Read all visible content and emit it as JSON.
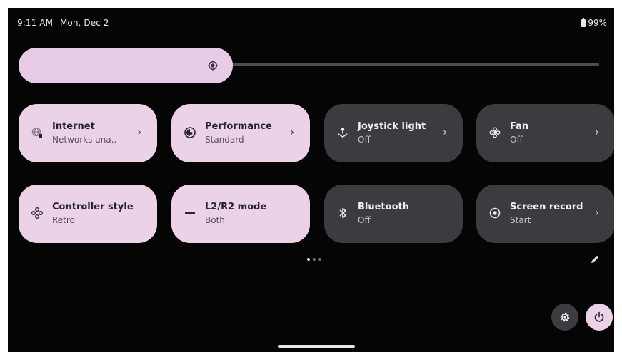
{
  "status_bar": {
    "time": "9:11 AM",
    "date": "Mon, Dec 2",
    "battery": "99%"
  },
  "brightness": {
    "level": 0.36,
    "icon": "brightness-icon"
  },
  "tiles": [
    {
      "title": "Internet",
      "subtitle": "Networks una..",
      "icon": "internet-icon",
      "state": "on",
      "has_chevron": true
    },
    {
      "title": "Performance",
      "subtitle": "Standard",
      "icon": "performance-icon",
      "state": "on",
      "has_chevron": true
    },
    {
      "title": "Joystick light",
      "subtitle": "Off",
      "icon": "joystick-icon",
      "state": "off",
      "has_chevron": true
    },
    {
      "title": "Fan",
      "subtitle": "Off",
      "icon": "fan-icon",
      "state": "off",
      "has_chevron": true
    },
    {
      "title": "Controller style",
      "subtitle": "Retro",
      "icon": "controller-icon",
      "state": "on",
      "has_chevron": false
    },
    {
      "title": "L2/R2 mode",
      "subtitle": "Both",
      "icon": "trigger-icon",
      "state": "on",
      "has_chevron": false
    },
    {
      "title": "Bluetooth",
      "subtitle": "Off",
      "icon": "bluetooth-icon",
      "state": "off",
      "has_chevron": false
    },
    {
      "title": "Screen record",
      "subtitle": "Start",
      "icon": "screen-record-icon",
      "state": "off",
      "has_chevron": true
    }
  ],
  "page_indicator": {
    "pages": 3,
    "current": 1
  },
  "colors": {
    "background": "#050505",
    "tile_on": "#ecd2e7",
    "tile_off": "#3d3b40",
    "accent": "#e8cce5"
  }
}
